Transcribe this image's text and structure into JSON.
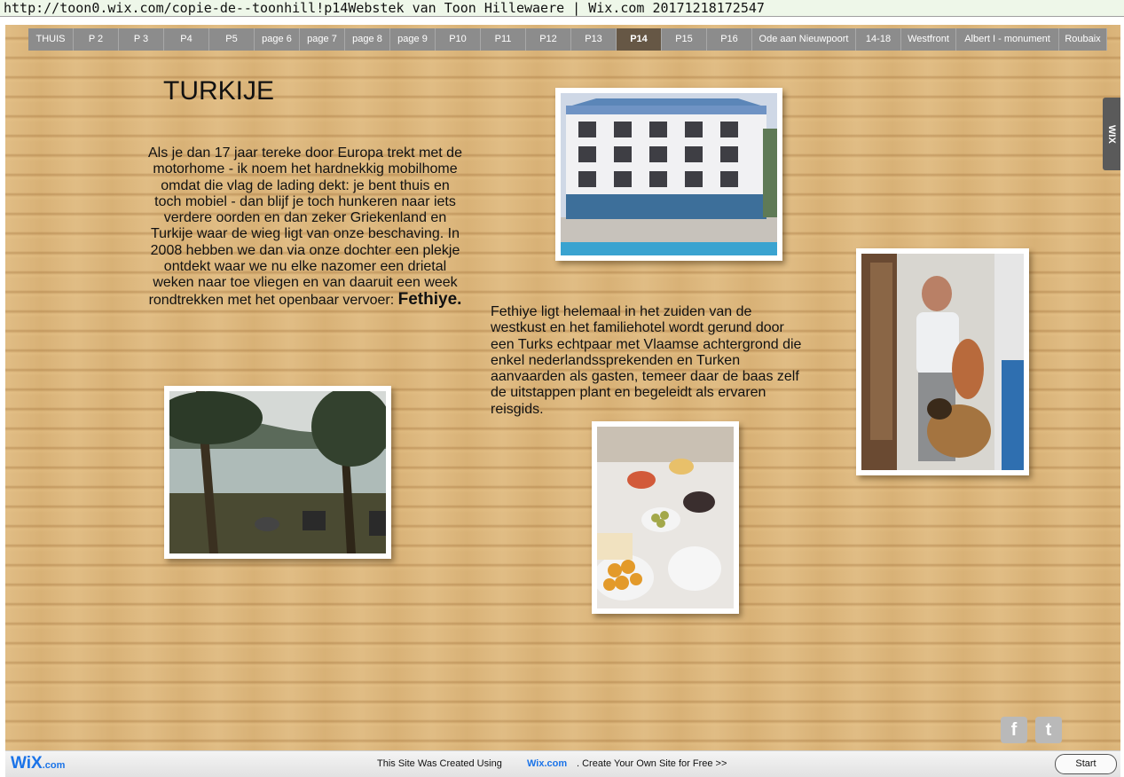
{
  "url_bar": {
    "text": "http://toon0.wix.com/copie-de--toonhill!p14Webstek van Toon Hillewaere | Wix.com 20171218172547"
  },
  "nav": {
    "items": [
      "THUIS",
      "P 2",
      "P 3",
      "P4",
      "P5",
      "page 6",
      "page 7",
      "page 8",
      "page 9",
      "P10",
      "P11",
      "P12",
      "P13",
      "P14",
      "P15",
      "P16",
      "Ode aan Nieuwpoort",
      "14-18",
      "Westfront",
      "Albert  I - monument",
      "Roubaix"
    ],
    "active": "P14"
  },
  "content": {
    "title": "TURKIJE",
    "para1": "Als je dan 17 jaar tereke door Europa trekt met de motorhome - ik noem het hardnekkig mobilhome   omdat die vlag de lading dekt: je bent thuis en toch mobiel - dan blijf je toch hunkeren naar iets verdere oorden en dan zeker Griekenland en Turkije waar de wieg ligt van onze beschaving. In 2008 hebben we dan via onze dochter een plekje ontdekt waar we nu elke nazomer een drietal weken naar toe vliegen en van daaruit een week rondtrekken met het openbaar vervoer:",
    "para1_emphasis": "Fethiye.",
    "para2": " Fethiye ligt helemaal in het zuiden van de westkust en het familiehotel wordt gerund door een Turks echtpaar met Vlaamse achtergrond die enkel nederlandssprekenden en Turken aanvaarden als gasten, temeer daar de baas zelf de uitstappen plant en begeleidt als ervaren reisgids."
  },
  "side_tab": {
    "label": "WIX"
  },
  "social": {
    "facebook": "f",
    "twitter": "t"
  },
  "footer": {
    "logo_main": "WiX",
    "logo_suffix": ".com",
    "created_text": "This Site Was Created Using",
    "wix_link": "Wix.com",
    "cta_text": ". Create Your Own Site for Free >>",
    "start_button": "Start"
  },
  "colors": {
    "nav_bg": "#8c8c8c",
    "nav_active": "#665745",
    "wix_blue": "#1a73e8",
    "wood": "#ddb77c"
  }
}
